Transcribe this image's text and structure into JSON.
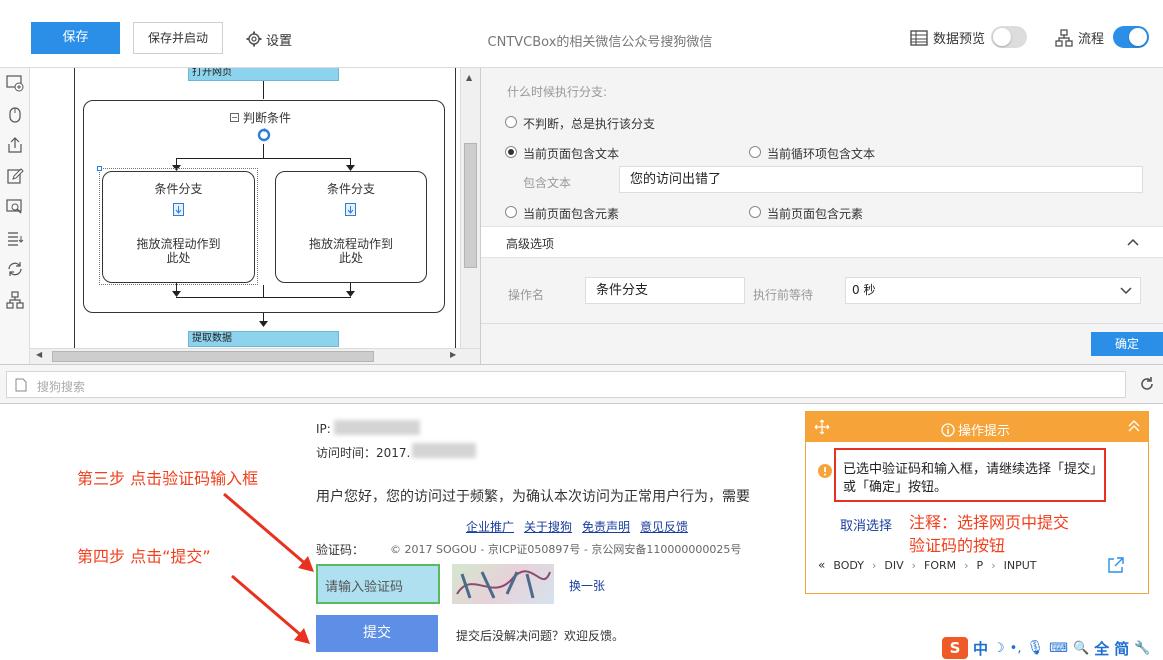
{
  "toolbar": {
    "save": "保存",
    "save_and_start": "保存并启动",
    "settings": "设置",
    "task_title": "CNTVCBox的相关微信公众号搜狗微信",
    "data_preview": "数据预览",
    "data_preview_on": false,
    "flow": "流程",
    "flow_on": true,
    "accent_color": "#2b8fe8"
  },
  "left_tools": [
    "add-step-icon",
    "mouse-icon",
    "export-icon",
    "edit-icon",
    "search-icon",
    "list-icon",
    "refresh-icon",
    "flow-tree-icon"
  ],
  "flow": {
    "top_step": "打开网页",
    "condition_title": "判断条件",
    "branch_title": "条件分支",
    "branch_hint_line1": "拖放流程动作到",
    "branch_hint_line2": "此处",
    "bottom_step": "提取数据"
  },
  "branch_settings": {
    "question": "什么时候执行分支:",
    "opt_no_judge": "不判断，总是执行该分支",
    "opt_page_text": "当前页面包含文本",
    "opt_loop_text": "当前循环项包含文本",
    "contains_text_label": "包含文本",
    "contains_text_value": "您的访问出错了",
    "opt_page_element": "当前页面包含元素",
    "opt_page_element_2": "当前页面包含元素",
    "advanced": "高级选项",
    "op_name_label": "操作名",
    "op_name_value": "条件分支",
    "wait_label": "执行前等待",
    "wait_value": "0 秒",
    "confirm": "确定"
  },
  "browser": {
    "address_placeholder": "搜狗搜索"
  },
  "webpage": {
    "ip_label": "IP:",
    "visit_time_label": "访问时间：2017.",
    "message": "用户您好，您的访问过于频繁，为确认本次访问为正常用户行为，需要",
    "links": [
      "企业推广",
      "关于搜狗",
      "免责声明",
      "意见反馈"
    ],
    "captcha_label": "验证码：",
    "copyright": "© 2017 SOGOU - 京ICP证050897号 - 京公网安备110000000025号",
    "captcha_placeholder": "请输入验证码",
    "change_one": "换一张",
    "submit": "提交",
    "after_submit": "提交后没解决问题？欢迎反馈。"
  },
  "annotations": {
    "step3": "第三步 点击验证码输入框",
    "step4": "第四步 点击“提交”",
    "note_line1": "注释：选择网页中提交",
    "note_line2": "验证码的按钮"
  },
  "tip_panel": {
    "title": "操作提示",
    "message": "已选中验证码和输入框，请继续选择「提交」或「确定」按钮。",
    "cancel": "取消选择",
    "breadcrumb": [
      "BODY",
      "DIV",
      "FORM",
      "P",
      "INPUT"
    ]
  },
  "ime": {
    "chars": [
      "中",
      "全",
      "简"
    ]
  }
}
